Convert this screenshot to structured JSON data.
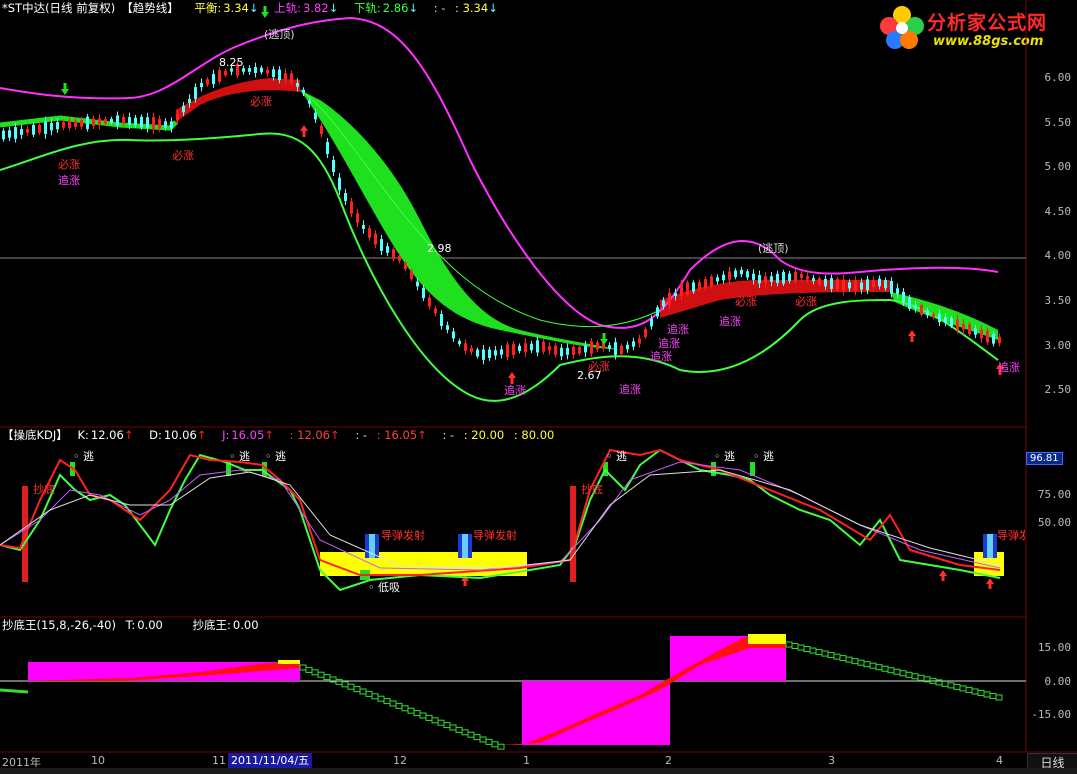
{
  "main_header": {
    "title": "*ST中达(日线 前复权)",
    "indicator": "【趋势线】",
    "balance_label": "平衡:",
    "balance_value": "3.34",
    "upper_label": "上轨:",
    "upper_value": "3.82",
    "lower_label": "下轨:",
    "lower_value": "2.86",
    "extra_a": ": -",
    "extra_b": ": 3.34"
  },
  "kdj_header": {
    "title": "【操底KDJ】",
    "k_label": "K:",
    "k_value": "12.06",
    "d_label": "D:",
    "d_value": "10.06",
    "j_label": "J:",
    "j_value": "16.05",
    "e1": ": 12.06",
    "e2": ": -",
    "e3": ": 16.05",
    "e4": ": -",
    "e5": ": 20.00",
    "e6": ": 80.00"
  },
  "cdw_header": {
    "title": "抄底王(15,8,-26,-40)",
    "t_label": "T:",
    "t_value": "0.00",
    "name_label": "抄底王:",
    "name_value": "0.00"
  },
  "watermark": {
    "brand": "分析家公式网",
    "url": "www.88gs.com"
  },
  "price_axis": [
    "6.00",
    "5.50",
    "5.00",
    "4.50",
    "4.00",
    "3.50",
    "3.00",
    "2.50"
  ],
  "kdj_axis": {
    "top": "96.81",
    "ticks": [
      "75.00",
      "50.00"
    ]
  },
  "cdw_axis": [
    "15.00",
    "0.00",
    "-15.00"
  ],
  "x_labels": [
    "2011年",
    "10",
    "11",
    "12",
    "1",
    "2",
    "3",
    "4"
  ],
  "date_flag": "2011/11/04/五",
  "period_button": "日线",
  "price_annotations": {
    "hi_marker": "8.25",
    "mid_marker": "2.98",
    "lo_marker": "2.67",
    "escape_top1": "(逃顶)",
    "escape_top2": "(逃顶)"
  },
  "signal_labels": {
    "bizhang": "必涨",
    "zhuizhang": "追涨",
    "taodi": "逃",
    "chaodi": "抄底",
    "missile": "导弹发射",
    "dixi": "低吸"
  },
  "colors": {
    "up_red": "#ff2020",
    "down_cyan": "#54ffff",
    "band_magenta": "#ff30ff",
    "band_green": "#40ff40",
    "fill_green": "#1ee01e",
    "fill_red": "#d01010",
    "yellow": "#ffff00"
  },
  "chart_data": [
    {
      "type": "line",
      "title": "【趋势线】",
      "xlabel": "",
      "ylabel": "",
      "ylim": [
        2.3,
        6.3
      ],
      "x": [
        "2011年",
        "10",
        "11",
        "12",
        "1",
        "2",
        "3",
        "4"
      ],
      "series": [
        {
          "name": "上轨",
          "values": [
            5.85,
            5.78,
            5.9,
            6.45,
            5.55,
            4.0,
            3.15,
            4.05,
            3.82
          ]
        },
        {
          "name": "平衡",
          "values": [
            5.4,
            5.35,
            5.75,
            5.95,
            4.3,
            3.1,
            3.05,
            3.55,
            3.34
          ]
        },
        {
          "name": "下轨",
          "values": [
            5.0,
            5.1,
            5.2,
            5.3,
            3.2,
            2.45,
            2.85,
            3.45,
            2.86
          ]
        }
      ]
    },
    {
      "type": "line",
      "title": "【操底KDJ】",
      "ylim": [
        0,
        100
      ],
      "series": [
        {
          "name": "K",
          "values": [
            40,
            70,
            35,
            80,
            30,
            5,
            10,
            85,
            90,
            55,
            30,
            12.06
          ]
        },
        {
          "name": "D",
          "values": [
            38,
            62,
            40,
            72,
            35,
            10,
            12,
            75,
            80,
            58,
            40,
            10.06
          ]
        },
        {
          "name": "J",
          "values": [
            45,
            90,
            25,
            95,
            20,
            -5,
            8,
            100,
            95,
            45,
            15,
            16.05
          ]
        }
      ]
    },
    {
      "type": "bar",
      "title": "抄底王(15,8,-26,-40)",
      "ylim": [
        -20,
        20
      ],
      "series": [
        {
          "name": "抄底王",
          "values": [
            -1,
            1,
            3,
            0,
            -8,
            -14,
            -10,
            -2,
            6,
            12,
            17,
            10,
            4,
            -2,
            -5
          ]
        }
      ]
    }
  ]
}
